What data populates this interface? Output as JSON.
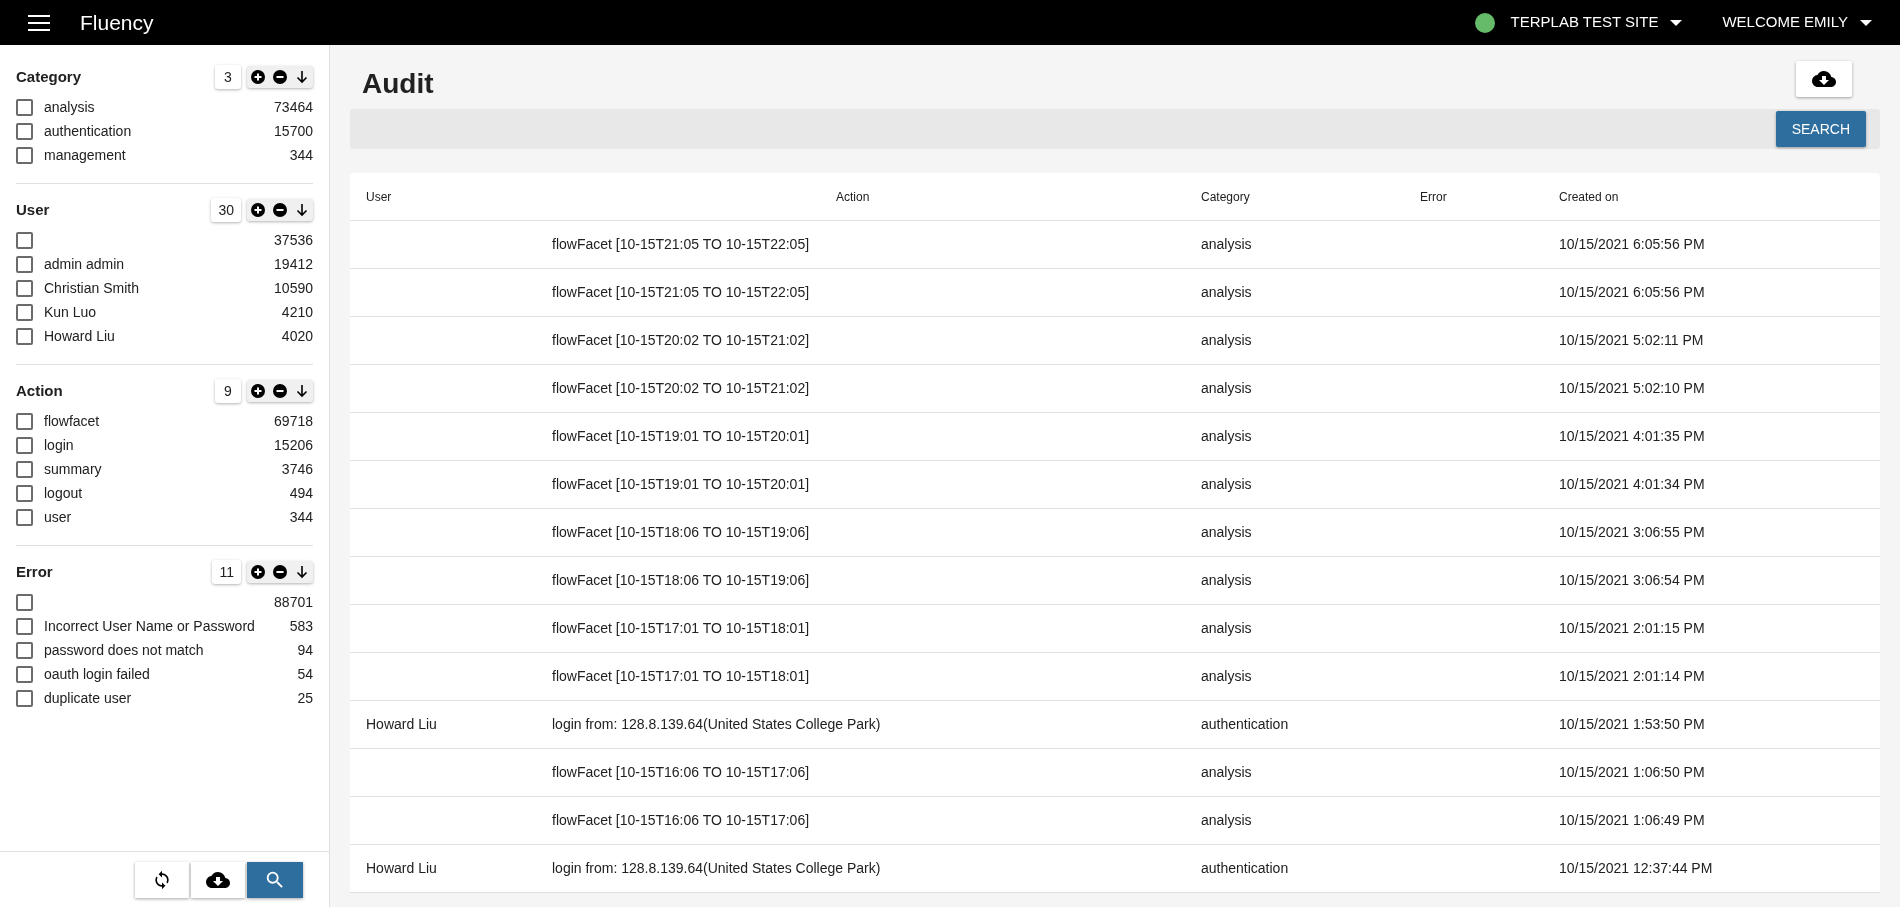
{
  "app_bar": {
    "title": "Fluency",
    "site": {
      "label": "TERPLAB TEST SITE",
      "color": "#66bb6a"
    },
    "user_menu": "WELCOME EMILY"
  },
  "filters": [
    {
      "title": "Category",
      "count": "3",
      "items": [
        {
          "label": "analysis",
          "count": "73464",
          "checked": false
        },
        {
          "label": "authentication",
          "count": "15700",
          "checked": false
        },
        {
          "label": "management",
          "count": "344",
          "checked": false
        }
      ]
    },
    {
      "title": "User",
      "count": "30",
      "items": [
        {
          "count": "37536",
          "checked": false
        },
        {
          "label": "admin admin",
          "count": "19412",
          "checked": false
        },
        {
          "label": "Christian Smith",
          "count": "10590",
          "checked": false
        },
        {
          "label": "Kun Luo",
          "count": "4210",
          "checked": false
        },
        {
          "label": "Howard Liu",
          "count": "4020",
          "checked": false
        }
      ]
    },
    {
      "title": "Action",
      "count": "9",
      "items": [
        {
          "label": "flowfacet",
          "count": "69718",
          "checked": false
        },
        {
          "label": "login",
          "count": "15206",
          "checked": false
        },
        {
          "label": "summary",
          "count": "3746",
          "checked": false
        },
        {
          "label": "logout",
          "count": "494",
          "checked": false
        },
        {
          "label": "user",
          "count": "344",
          "checked": false
        }
      ]
    },
    {
      "title": "Error",
      "count": "11",
      "items": [
        {
          "count": "88701",
          "checked": false
        },
        {
          "label": "Incorrect User Name or Password",
          "count": "583",
          "checked": false
        },
        {
          "label": "password does not match",
          "count": "94",
          "checked": false
        },
        {
          "label": "oauth login failed",
          "count": "54",
          "checked": false
        },
        {
          "label": "duplicate user",
          "count": "25",
          "checked": false
        }
      ]
    }
  ],
  "page_title": "Audit",
  "search_button": "SEARCH",
  "table": {
    "columns": [
      "User",
      "Action",
      "Category",
      "Error",
      "Created on"
    ],
    "rows": [
      [
        "",
        "flowFacet [10-15T21:05 TO 10-15T22:05]",
        "analysis",
        "",
        "10/15/2021 6:05:56 PM"
      ],
      [
        "",
        "flowFacet [10-15T21:05 TO 10-15T22:05]",
        "analysis",
        "",
        "10/15/2021 6:05:56 PM"
      ],
      [
        "",
        "flowFacet [10-15T20:02 TO 10-15T21:02]",
        "analysis",
        "",
        "10/15/2021 5:02:11 PM"
      ],
      [
        "",
        "flowFacet [10-15T20:02 TO 10-15T21:02]",
        "analysis",
        "",
        "10/15/2021 5:02:10 PM"
      ],
      [
        "",
        "flowFacet [10-15T19:01 TO 10-15T20:01]",
        "analysis",
        "",
        "10/15/2021 4:01:35 PM"
      ],
      [
        "",
        "flowFacet [10-15T19:01 TO 10-15T20:01]",
        "analysis",
        "",
        "10/15/2021 4:01:34 PM"
      ],
      [
        "",
        "flowFacet [10-15T18:06 TO 10-15T19:06]",
        "analysis",
        "",
        "10/15/2021 3:06:55 PM"
      ],
      [
        "",
        "flowFacet [10-15T18:06 TO 10-15T19:06]",
        "analysis",
        "",
        "10/15/2021 3:06:54 PM"
      ],
      [
        "",
        "flowFacet [10-15T17:01 TO 10-15T18:01]",
        "analysis",
        "",
        "10/15/2021 2:01:15 PM"
      ],
      [
        "",
        "flowFacet [10-15T17:01 TO 10-15T18:01]",
        "analysis",
        "",
        "10/15/2021 2:01:14 PM"
      ],
      [
        "Howard Liu",
        "login from: 128.8.139.64(United States College Park)",
        "authentication",
        "",
        "10/15/2021 1:53:50 PM"
      ],
      [
        "",
        "flowFacet [10-15T16:06 TO 10-15T17:06]",
        "analysis",
        "",
        "10/15/2021 1:06:50 PM"
      ],
      [
        "",
        "flowFacet [10-15T16:06 TO 10-15T17:06]",
        "analysis",
        "",
        "10/15/2021 1:06:49 PM"
      ],
      [
        "Howard Liu",
        "login from: 128.8.139.64(United States College Park)",
        "authentication",
        "",
        "10/15/2021 12:37:44 PM"
      ]
    ]
  }
}
